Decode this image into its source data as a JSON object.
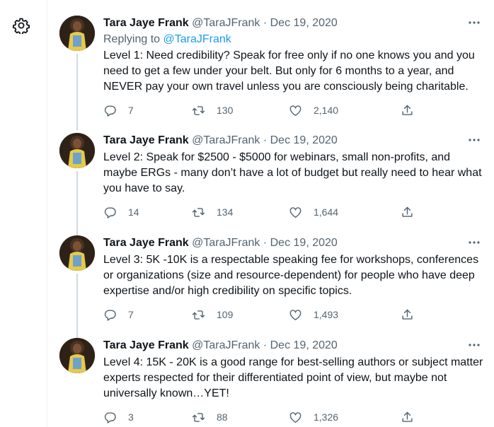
{
  "tweets": [
    {
      "name": "Tara Jaye Frank",
      "handle": "@TaraJFrank",
      "sep": "·",
      "date": "Dec 19, 2020",
      "reply_prefix": "Replying to",
      "reply_handle": "@TaraJFrank",
      "text": "Level 1: Need credibility? Speak for free only if no one knows you and you need to get a few under your belt. But only for 6 months to a year, and NEVER pay your own travel unless you are consciously being charitable.",
      "replies": "7",
      "retweets": "130",
      "likes": "2,140"
    },
    {
      "name": "Tara Jaye Frank",
      "handle": "@TaraJFrank",
      "sep": "·",
      "date": "Dec 19, 2020",
      "text": "Level 2: Speak for $2500 - $5000 for webinars, small non-profits, and maybe ERGs - many don’t have a lot of budget but really need to hear what you have to say.",
      "replies": "14",
      "retweets": "134",
      "likes": "1,644"
    },
    {
      "name": "Tara Jaye Frank",
      "handle": "@TaraJFrank",
      "sep": "·",
      "date": "Dec 19, 2020",
      "text": "Level 3: 5K -10K is a respectable speaking fee for workshops, conferences or organizations (size and resource-dependent) for people who have deep expertise and/or high credibility on specific topics.",
      "replies": "7",
      "retweets": "109",
      "likes": "1,493"
    },
    {
      "name": "Tara Jaye Frank",
      "handle": "@TaraJFrank",
      "sep": "·",
      "date": "Dec 19, 2020",
      "text": "Level 4: 15K - 20K is a good range for best-selling authors or subject matter experts respected for their differentiated point of view, but maybe not universally known…YET!",
      "replies": "3",
      "retweets": "88",
      "likes": "1,326"
    }
  ],
  "colors": {
    "text": "#0f1419",
    "secondary": "#536471",
    "link": "#1d9bf0",
    "thread_line": "#cfd9de"
  }
}
